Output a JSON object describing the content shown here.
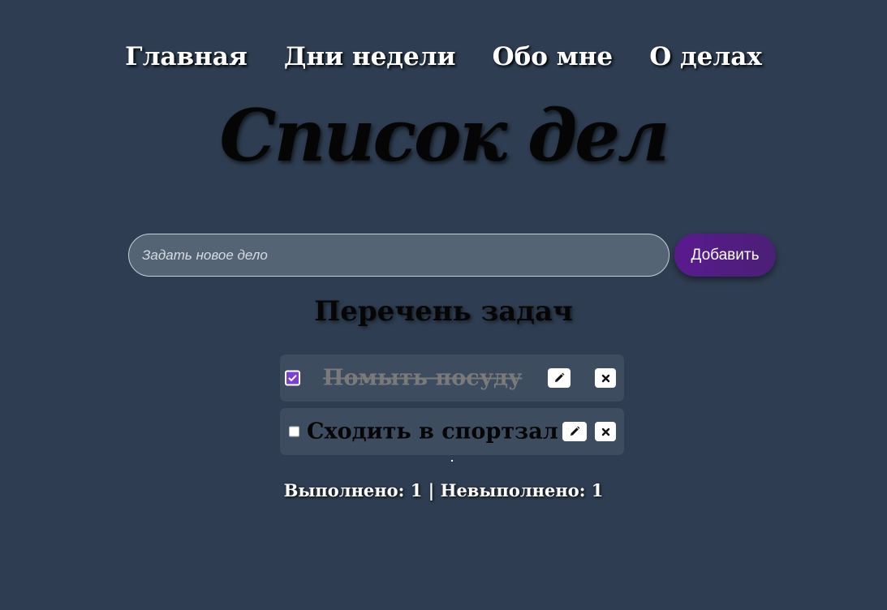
{
  "nav": {
    "items": [
      {
        "label": "Главная"
      },
      {
        "label": "Дни недели"
      },
      {
        "label": "Обо мне"
      },
      {
        "label": "О делах"
      }
    ]
  },
  "header": {
    "title": "Список дел"
  },
  "add_form": {
    "input_value": "",
    "input_placeholder": "Задать новое дело",
    "add_label": "Добавить"
  },
  "list": {
    "heading": "Перечень задач",
    "tasks": [
      {
        "text": "Помыть посуду",
        "done": true,
        "edit_icon": "pencil-icon",
        "delete_icon": "close-icon"
      },
      {
        "text": "Сходить в спортзал",
        "done": false,
        "edit_icon": "pencil-icon",
        "delete_icon": "close-icon"
      }
    ]
  },
  "stats": {
    "text": "Выполнено: 1 | Невыполнено: 1"
  },
  "colors": {
    "background": "#2e3d51",
    "task_bg": "#3e4c5f",
    "accent": "#5a1a8f",
    "checkbox_checked": "#7b3fd6",
    "input_bg": "#546474"
  }
}
